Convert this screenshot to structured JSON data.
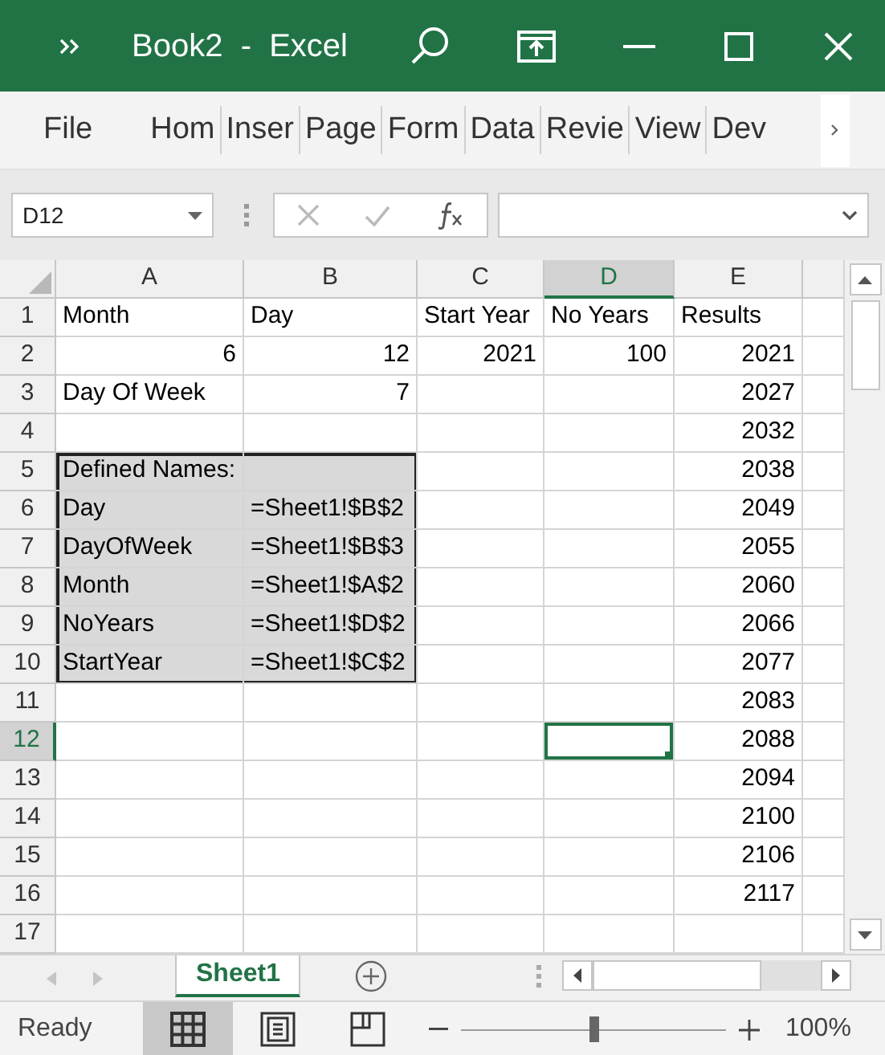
{
  "title_bar": {
    "title": "Book2  -  Excel"
  },
  "ribbon_tabs": [
    {
      "label": "File"
    },
    {
      "label": "Hom"
    },
    {
      "label": "Inser"
    },
    {
      "label": "Page"
    },
    {
      "label": "Form"
    },
    {
      "label": "Data"
    },
    {
      "label": "Revie"
    },
    {
      "label": "View"
    },
    {
      "label": "Dev"
    }
  ],
  "formula_bar": {
    "name_box": "D12"
  },
  "column_headers": [
    {
      "label": "A",
      "selected": false
    },
    {
      "label": "B",
      "selected": false
    },
    {
      "label": "C",
      "selected": false
    },
    {
      "label": "D",
      "selected": true
    },
    {
      "label": "E",
      "selected": false
    }
  ],
  "rows": [
    {
      "header": "1",
      "selected": false,
      "cells": [
        {
          "value": "Month",
          "kind": "text",
          "shaded": false
        },
        {
          "value": "Day",
          "kind": "text",
          "shaded": false
        },
        {
          "value": "Start Year",
          "kind": "text",
          "shaded": false
        },
        {
          "value": "No Years",
          "kind": "text",
          "shaded": false
        },
        {
          "value": "Results",
          "kind": "text",
          "shaded": false
        }
      ]
    },
    {
      "header": "2",
      "selected": false,
      "cells": [
        {
          "value": "6",
          "kind": "number",
          "shaded": false
        },
        {
          "value": "12",
          "kind": "number",
          "shaded": false
        },
        {
          "value": "2021",
          "kind": "number",
          "shaded": false
        },
        {
          "value": "100",
          "kind": "number",
          "shaded": false
        },
        {
          "value": "2021",
          "kind": "number",
          "shaded": false
        }
      ]
    },
    {
      "header": "3",
      "selected": false,
      "cells": [
        {
          "value": "Day Of Week",
          "kind": "text",
          "shaded": false
        },
        {
          "value": "7",
          "kind": "number",
          "shaded": false
        },
        {
          "shaded": false
        },
        {
          "shaded": false
        },
        {
          "value": "2027",
          "kind": "number",
          "shaded": false
        }
      ]
    },
    {
      "header": "4",
      "selected": false,
      "cells": [
        {
          "shaded": false
        },
        {
          "shaded": false
        },
        {
          "shaded": false
        },
        {
          "shaded": false
        },
        {
          "value": "2032",
          "kind": "number",
          "shaded": false
        }
      ]
    },
    {
      "header": "5",
      "selected": false,
      "cells": [
        {
          "value": "Defined Names:",
          "kind": "text",
          "shaded": true
        },
        {
          "shaded": true
        },
        {
          "shaded": false
        },
        {
          "shaded": false
        },
        {
          "value": "2038",
          "kind": "number",
          "shaded": false
        }
      ]
    },
    {
      "header": "6",
      "selected": false,
      "cells": [
        {
          "value": "Day",
          "kind": "text",
          "shaded": true
        },
        {
          "value": "=Sheet1!$B$2",
          "kind": "text",
          "shaded": true
        },
        {
          "shaded": false
        },
        {
          "shaded": false
        },
        {
          "value": "2049",
          "kind": "number",
          "shaded": false
        }
      ]
    },
    {
      "header": "7",
      "selected": false,
      "cells": [
        {
          "value": "DayOfWeek",
          "kind": "text",
          "shaded": true
        },
        {
          "value": "=Sheet1!$B$3",
          "kind": "text",
          "shaded": true
        },
        {
          "shaded": false
        },
        {
          "shaded": false
        },
        {
          "value": "2055",
          "kind": "number",
          "shaded": false
        }
      ]
    },
    {
      "header": "8",
      "selected": false,
      "cells": [
        {
          "value": "Month",
          "kind": "text",
          "shaded": true
        },
        {
          "value": "=Sheet1!$A$2",
          "kind": "text",
          "shaded": true
        },
        {
          "shaded": false
        },
        {
          "shaded": false
        },
        {
          "value": "2060",
          "kind": "number",
          "shaded": false
        }
      ]
    },
    {
      "header": "9",
      "selected": false,
      "cells": [
        {
          "value": "NoYears",
          "kind": "text",
          "shaded": true
        },
        {
          "value": "=Sheet1!$D$2",
          "kind": "text",
          "shaded": true
        },
        {
          "shaded": false
        },
        {
          "shaded": false
        },
        {
          "value": "2066",
          "kind": "number",
          "shaded": false
        }
      ]
    },
    {
      "header": "10",
      "selected": false,
      "cells": [
        {
          "value": "StartYear",
          "kind": "text",
          "shaded": true
        },
        {
          "value": "=Sheet1!$C$2",
          "kind": "text",
          "shaded": true
        },
        {
          "shaded": false
        },
        {
          "shaded": false
        },
        {
          "value": "2077",
          "kind": "number",
          "shaded": false
        }
      ]
    },
    {
      "header": "11",
      "selected": false,
      "cells": [
        {
          "shaded": false
        },
        {
          "shaded": false
        },
        {
          "shaded": false
        },
        {
          "shaded": false
        },
        {
          "value": "2083",
          "kind": "number",
          "shaded": false
        }
      ]
    },
    {
      "header": "12",
      "selected": true,
      "cells": [
        {
          "shaded": false
        },
        {
          "shaded": false
        },
        {
          "shaded": false
        },
        {
          "shaded": false
        },
        {
          "value": "2088",
          "kind": "number",
          "shaded": false
        }
      ]
    },
    {
      "header": "13",
      "selected": false,
      "cells": [
        {
          "shaded": false
        },
        {
          "shaded": false
        },
        {
          "shaded": false
        },
        {
          "shaded": false
        },
        {
          "value": "2094",
          "kind": "number",
          "shaded": false
        }
      ]
    },
    {
      "header": "14",
      "selected": false,
      "cells": [
        {
          "shaded": false
        },
        {
          "shaded": false
        },
        {
          "shaded": false
        },
        {
          "shaded": false
        },
        {
          "value": "2100",
          "kind": "number",
          "shaded": false
        }
      ]
    },
    {
      "header": "15",
      "selected": false,
      "cells": [
        {
          "shaded": false
        },
        {
          "shaded": false
        },
        {
          "shaded": false
        },
        {
          "shaded": false
        },
        {
          "value": "2106",
          "kind": "number",
          "shaded": false
        }
      ]
    },
    {
      "header": "16",
      "selected": false,
      "cells": [
        {
          "shaded": false
        },
        {
          "shaded": false
        },
        {
          "shaded": false
        },
        {
          "shaded": false
        },
        {
          "value": "2117",
          "kind": "number",
          "shaded": false
        }
      ]
    },
    {
      "header": "17",
      "selected": false,
      "cells": [
        {
          "shaded": false
        },
        {
          "shaded": false
        },
        {
          "shaded": false
        },
        {
          "shaded": false
        },
        {
          "shaded": false
        }
      ]
    }
  ],
  "sheet_tabs": [
    {
      "label": "Sheet1",
      "selected": true
    }
  ],
  "status_bar": {
    "status": "Ready",
    "views": [
      {
        "kind": "normal",
        "selected": true
      },
      {
        "kind": "page_layout",
        "selected": false
      },
      {
        "kind": "page_break",
        "selected": false
      }
    ],
    "zoom": {
      "level": 0.5,
      "reading": "100%"
    }
  }
}
